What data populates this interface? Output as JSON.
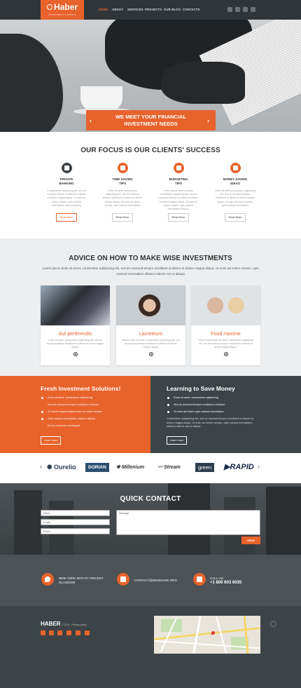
{
  "header": {
    "logo": "Haber",
    "logo_tagline": "INVESTMENT COMPANY",
    "nav": [
      "HOME",
      "ABOUT",
      "SERVICES",
      "PROJECTS",
      "OUR BLOG",
      "CONTACTS"
    ],
    "social_icons": [
      "twitter-icon",
      "youtube-icon",
      "facebook-icon",
      "rss-icon"
    ]
  },
  "hero": {
    "banner_line1": "WE MEET YOUR FINANCIAL",
    "banner_line2": "INVESTMENT NEEDS",
    "prev": "‹",
    "next": "›"
  },
  "focus": {
    "title": "OUR FOCUS IS OUR CLIENTS' SUCCESS",
    "items": [
      {
        "title": "PRIVATE\nBANKING",
        "text": "Consectetuer adipiscing elit, sed do eiusmod tempor incididunt ut labore et dolore magna aliqua. Ut enim ad minim veniam, quis nostrud exercitation ullamco laboris",
        "button": "Read More",
        "icon": "piggy-bank-icon"
      },
      {
        "title": "TIME SAVING\nTIPS",
        "text": "Color sit amet, consectetur adipisicing elit, sed do eiusmod tempor incididunt ut labore et dolore magna aliqua. Ut enim ad minim veniam, quis nostrud exercitation",
        "button": "Read More",
        "icon": "chart-icon"
      },
      {
        "title": "BUDGETING\nTIPS",
        "text": "Lorem ipsum dolor sit amet, consectetur adipisicing elit, sed do eiusmod tempor incididunt ut labore et dolore magna aliqua. Ut enim ad minim veniam, quis nostrud exercitation ullamco",
        "button": "Read More",
        "icon": "lock-icon"
      },
      {
        "title": "MONEY SAVING\nIDEAS",
        "text": "Color sit amet consectetur adipisicing elit, sed do eiusmod tempor incididunt ut labore et dolore magna aliqua. Ut enim ad minim veniam, quis nostrud exercitation",
        "button": "Read More",
        "icon": "coins-icon"
      }
    ]
  },
  "advice": {
    "title": "ADVICE ON HOW TO MAKE WISE INVESTMENTS",
    "text": "Lorem ipsum dolor sit amet, consectetur adipisicing elit, sed do eiusmod tempor incididunt ut labore et dolore magna aliqua. Ut enim ad minim veniam, quis nostrud exercitation ullamco laboris nisi ut aliquip",
    "cards": [
      {
        "title": "Aut perferendis",
        "text": "Color sit amet, consectetur adipisicing elit, sed do eiusmod tempor incididunt ut labore et dolore magna aliqua."
      },
      {
        "title": "Laoreetum",
        "text": "Mauris dolor sit amet, consectetur adipisicing elit, sed do eiusmod tempor incididunt ut labore et dolore magna aliqua."
      },
      {
        "title": "Fuod maxime",
        "text": "Lorem ipsum dolor sit amet, consectetur adipisicing elit, sed do eiusmod tempor incididunt ut labore et dolore magna aliqua."
      }
    ]
  },
  "split": {
    "left_title": "Fresh Investment Solutions!",
    "left_items": [
      "Dolor sit amet, consectetur adipisicing",
      "Sed do eiusmod tempor incididunt ut labore",
      "Et dolore magna aliqua enim ad minim veniam",
      "Duis nostrud exercitation ullamco laboris",
      "Ea ea commodo consequat"
    ],
    "left_button": "Learn more",
    "right_title": "Learning to Save Money",
    "right_items": [
      "Dolor sit amet, consectetur adipisicing",
      "Sed do eiusmod tempor incididunt ut labore",
      "Ut enim ad minim quis nostrud exercitation"
    ],
    "right_text": "Consectetur adipisicing elit, sed do eiusmod tempor incididunt ut labore et dolore magna aliqua. Ut enim ad minim veniam, quis nostrud exercitation ullamco laboris nisi ut aliquip.",
    "right_button": "Learn more"
  },
  "logos": {
    "items": [
      "Ourelio",
      "DORIAN",
      "Millenium",
      "Stream",
      "green",
      "RAPID"
    ],
    "prev": "‹",
    "next": "›"
  },
  "contact": {
    "title": "QUICK CONTACT",
    "name_placeholder": "Name",
    "email_placeholder": "E-mail",
    "phone_placeholder": "Phone",
    "message_placeholder": "Message",
    "send": "SEND"
  },
  "info": {
    "address": "NEW YORK 9870 ST VINCENT\nGLASGOW",
    "email": "CONTACT@DEMOLINK.ORG",
    "call_label": "CALL US:",
    "phone": "+1 800 603 6035"
  },
  "footer": {
    "logo": "HABER",
    "copyright": "© 2015 · Privacy policy",
    "up": "^"
  }
}
